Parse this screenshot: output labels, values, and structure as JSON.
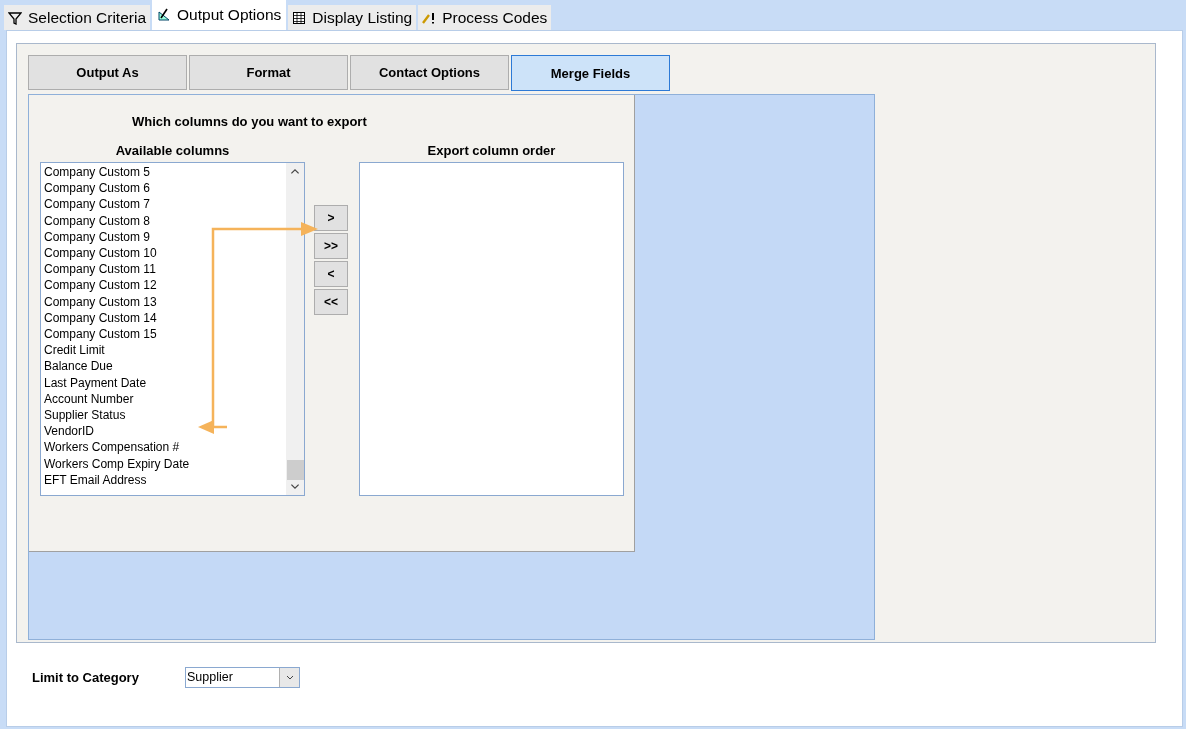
{
  "tabs": [
    {
      "label": "Selection Criteria",
      "selected": false
    },
    {
      "label": "Output Options",
      "selected": true
    },
    {
      "label": "Display Listing",
      "selected": false
    },
    {
      "label": "Process Codes",
      "selected": false
    }
  ],
  "sub_tabs": [
    {
      "label": "Output As",
      "selected": false
    },
    {
      "label": "Format",
      "selected": false
    },
    {
      "label": "Contact Options",
      "selected": false
    },
    {
      "label": "Merge Fields",
      "selected": true
    }
  ],
  "question": "Which columns do you want to export",
  "available": {
    "label": "Available columns",
    "items": [
      "Company Custom 5",
      "Company Custom 6",
      "Company Custom 7",
      "Company Custom 8",
      "Company Custom 9",
      "Company Custom 10",
      "Company Custom 11",
      "Company Custom 12",
      "Company Custom 13",
      "Company Custom 14",
      "Company Custom 15",
      "Credit Limit",
      "Balance Due",
      "Last Payment Date",
      "Account Number",
      "Supplier Status",
      "VendorID",
      "Workers Compensation #",
      "Workers Comp Expiry Date",
      "EFT Email Address"
    ]
  },
  "move_buttons": [
    ">",
    ">>",
    "<",
    "<<"
  ],
  "export": {
    "label": "Export column order"
  },
  "category": {
    "label": "Limit to Category",
    "value": "Supplier"
  }
}
